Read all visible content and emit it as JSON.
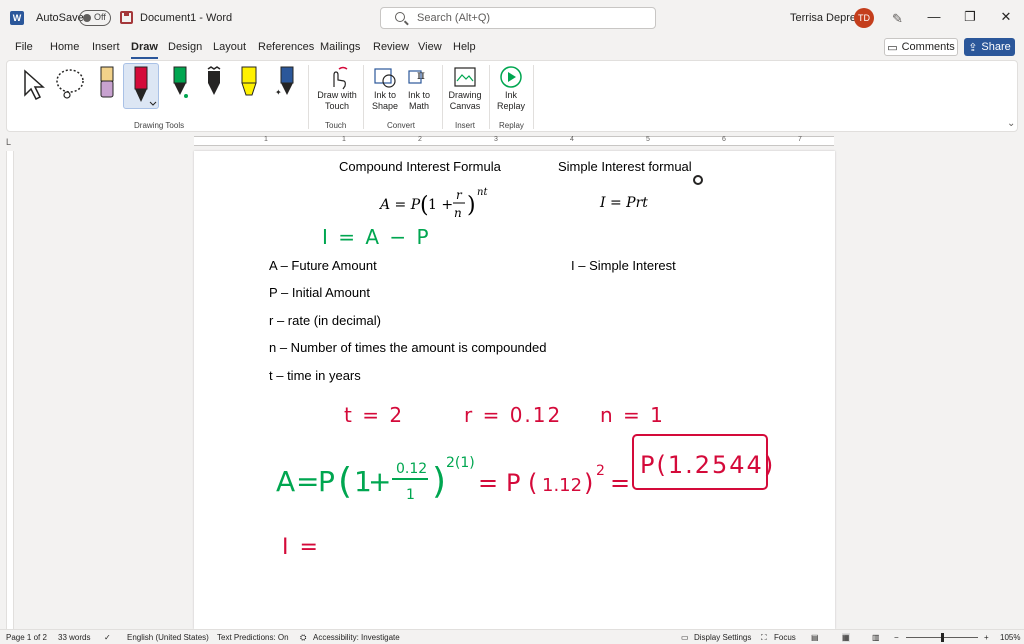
{
  "titlebar": {
    "autosave_label": "AutoSave",
    "autosave_state": "Off",
    "doc_title": "Document1  -  Word",
    "search_placeholder": "Search (Alt+Q)",
    "user_name": "Terrisa Deprez",
    "user_initials": "TD",
    "minimize": "—",
    "restore": "❐",
    "close": "✕"
  },
  "menu": {
    "tabs": [
      "File",
      "Home",
      "Insert",
      "Draw",
      "Design",
      "Layout",
      "References",
      "Mailings",
      "Review",
      "View",
      "Help"
    ],
    "active_tab": "Draw",
    "comments_label": "Comments",
    "share_label": "Share"
  },
  "ribbon": {
    "groups": {
      "drawing_tools": "Drawing Tools",
      "touch": "Touch",
      "convert": "Convert",
      "insert": "Insert",
      "replay": "Replay"
    },
    "draw_with_touch": "Draw with Touch",
    "ink_to_shape": "Ink to Shape",
    "ink_to_math": "Ink to Math",
    "drawing_canvas": "Drawing Canvas",
    "ink_replay": "Ink Replay"
  },
  "ruler": {
    "numbers": [
      "1",
      "1",
      "2",
      "3",
      "4",
      "5",
      "6",
      "7"
    ]
  },
  "document": {
    "compound_title": "Compound Interest Formula",
    "simple_title": "Simple Interest formual",
    "compound_formula": "A = P(1 + r/n)^nt",
    "simple_formula": "I = Prt",
    "def_a": "A – Future Amount",
    "def_p": "P – Initial Amount",
    "def_r": "r – rate (in decimal)",
    "def_n": "n – Number of times the amount is compounded",
    "def_t": "t – time in years",
    "def_i": "I – Simple Interest",
    "ink_green_1": "I = A − P",
    "ink_t": "t = 2",
    "ink_r": "r = 0.12",
    "ink_n": "n = 1",
    "ink_eq": "A = P(1 + 0.12/1)^2(1) = P(1.12)² =",
    "ink_boxed": "P(1.2544)",
    "ink_i": "I ="
  },
  "statusbar": {
    "page": "Page 1 of 2",
    "words": "33 words",
    "language": "English (United States)",
    "predictions": "Text Predictions: On",
    "accessibility": "Accessibility: Investigate",
    "display_settings": "Display Settings",
    "focus": "Focus",
    "zoom": "105%"
  },
  "colors": {
    "word_blue": "#2b579a",
    "ink_green": "#00a650",
    "ink_red": "#d40a3a"
  }
}
